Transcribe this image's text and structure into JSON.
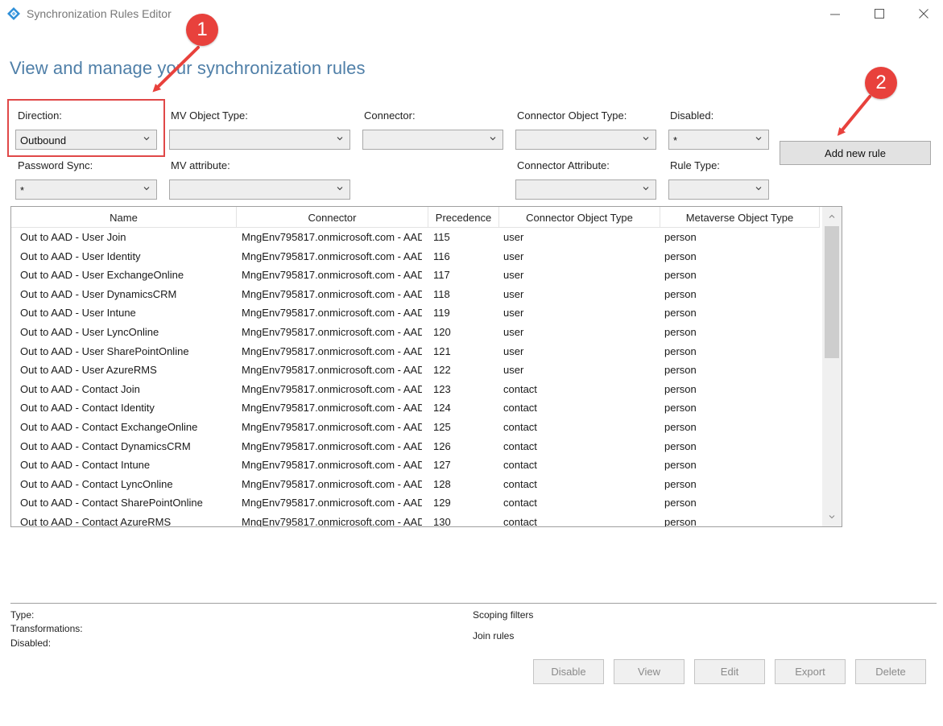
{
  "window": {
    "title": "Synchronization Rules Editor",
    "minimize_icon": "minimize-icon",
    "maximize_icon": "maximize-icon",
    "close_icon": "close-icon"
  },
  "page": {
    "title": "View and manage your synchronization rules"
  },
  "filters": {
    "direction": {
      "label": "Direction:",
      "value": "Outbound"
    },
    "mv_object_type": {
      "label": "MV Object Type:",
      "value": ""
    },
    "connector": {
      "label": "Connector:",
      "value": ""
    },
    "connector_object_type": {
      "label": "Connector Object Type:",
      "value": ""
    },
    "disabled": {
      "label": "Disabled:",
      "value": "*"
    },
    "password_sync": {
      "label": "Password Sync:",
      "value": "*"
    },
    "mv_attribute": {
      "label": "MV attribute:",
      "value": ""
    },
    "connector_attribute": {
      "label": "Connector Attribute:",
      "value": ""
    },
    "rule_type": {
      "label": "Rule Type:",
      "value": ""
    }
  },
  "add_rule_label": "Add new rule",
  "table": {
    "columns": [
      "Name",
      "Connector",
      "Precedence",
      "Connector Object Type",
      "Metaverse Object Type"
    ],
    "rows": [
      [
        "Out to AAD - User Join",
        "MngEnv795817.onmicrosoft.com - AAD",
        "115",
        "user",
        "person"
      ],
      [
        "Out to AAD - User Identity",
        "MngEnv795817.onmicrosoft.com - AAD",
        "116",
        "user",
        "person"
      ],
      [
        "Out to AAD - User ExchangeOnline",
        "MngEnv795817.onmicrosoft.com - AAD",
        "117",
        "user",
        "person"
      ],
      [
        "Out to AAD - User DynamicsCRM",
        "MngEnv795817.onmicrosoft.com - AAD",
        "118",
        "user",
        "person"
      ],
      [
        "Out to AAD - User Intune",
        "MngEnv795817.onmicrosoft.com - AAD",
        "119",
        "user",
        "person"
      ],
      [
        "Out to AAD - User LyncOnline",
        "MngEnv795817.onmicrosoft.com - AAD",
        "120",
        "user",
        "person"
      ],
      [
        "Out to AAD - User SharePointOnline",
        "MngEnv795817.onmicrosoft.com - AAD",
        "121",
        "user",
        "person"
      ],
      [
        "Out to AAD - User AzureRMS",
        "MngEnv795817.onmicrosoft.com - AAD",
        "122",
        "user",
        "person"
      ],
      [
        "Out to AAD - Contact Join",
        "MngEnv795817.onmicrosoft.com - AAD",
        "123",
        "contact",
        "person"
      ],
      [
        "Out to AAD - Contact Identity",
        "MngEnv795817.onmicrosoft.com - AAD",
        "124",
        "contact",
        "person"
      ],
      [
        "Out to AAD - Contact ExchangeOnline",
        "MngEnv795817.onmicrosoft.com - AAD",
        "125",
        "contact",
        "person"
      ],
      [
        "Out to AAD - Contact DynamicsCRM",
        "MngEnv795817.onmicrosoft.com - AAD",
        "126",
        "contact",
        "person"
      ],
      [
        "Out to AAD - Contact Intune",
        "MngEnv795817.onmicrosoft.com - AAD",
        "127",
        "contact",
        "person"
      ],
      [
        "Out to AAD - Contact LyncOnline",
        "MngEnv795817.onmicrosoft.com - AAD",
        "128",
        "contact",
        "person"
      ],
      [
        "Out to AAD - Contact SharePointOnline",
        "MngEnv795817.onmicrosoft.com - AAD",
        "129",
        "contact",
        "person"
      ],
      [
        "Out to AAD - Contact AzureRMS",
        "MngEnv795817.onmicrosoft.com - AAD",
        "130",
        "contact",
        "person"
      ]
    ]
  },
  "details": {
    "type_label": "Type:",
    "transformations_label": "Transformations:",
    "disabled_label": "Disabled:",
    "scoping_filters_label": "Scoping filters",
    "join_rules_label": "Join rules"
  },
  "actions": {
    "disable": "Disable",
    "view": "View",
    "edit": "Edit",
    "export": "Export",
    "delete": "Delete"
  },
  "callouts": {
    "one": "1",
    "two": "2"
  },
  "colors": {
    "title_blue": "#4f7fa8",
    "callout_red": "#e8413c",
    "highlight_red": "#e04848",
    "app_icon_blue": "#2f8fd8"
  }
}
